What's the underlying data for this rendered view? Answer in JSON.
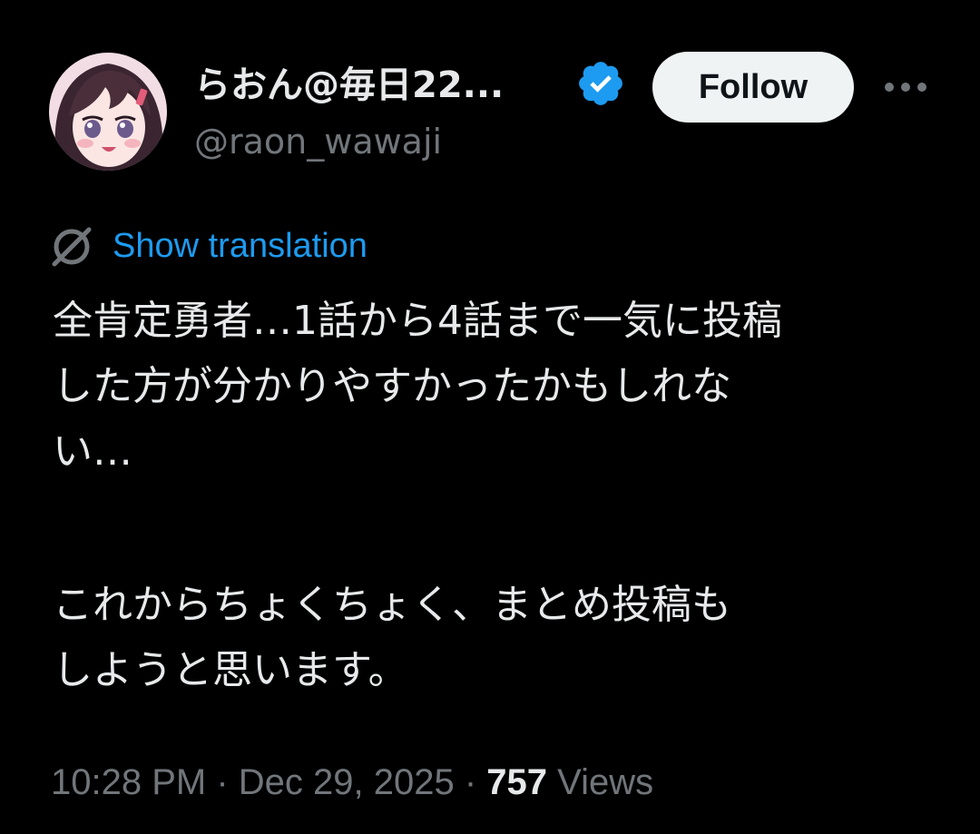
{
  "author": {
    "display_name": "らおん@毎日22...",
    "handle": "@raon_wawaji",
    "verified_color": "#1d9bf0"
  },
  "actions": {
    "follow_label": "Follow",
    "more_icon": "ellipsis-icon"
  },
  "translation": {
    "label": "Show translation",
    "icon": "translate-icon",
    "link_color": "#1d9bf0"
  },
  "tweet": {
    "paragraph_1": "全肯定勇者…1話から4話まで一気に投稿\nした方が分かりやすかったかもしれな\nい…",
    "paragraph_2": "これからちょくちょく、まとめ投稿も\nしようと思います。"
  },
  "meta": {
    "time": "10:28 PM",
    "separator": " · ",
    "date": "Dec 29, 2025",
    "views_count": "757",
    "views_label": "Views"
  }
}
